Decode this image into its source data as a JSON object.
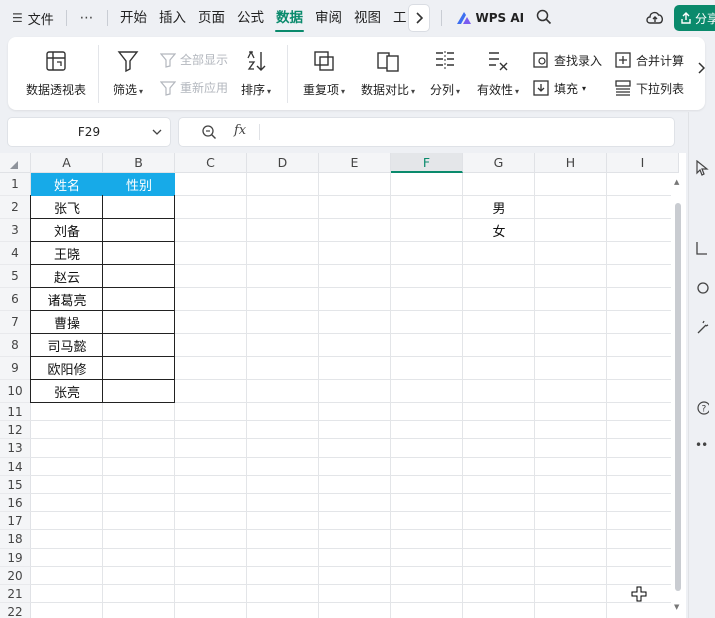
{
  "menubar": {
    "file_label": "文件",
    "more_label": "⋯",
    "tabs": [
      {
        "label": "开始"
      },
      {
        "label": "插入"
      },
      {
        "label": "页面"
      },
      {
        "label": "公式"
      },
      {
        "label": "数据"
      },
      {
        "label": "审阅"
      },
      {
        "label": "视图"
      },
      {
        "label": "工"
      }
    ],
    "active_tab": "数据",
    "wps_ai_label": "WPS AI",
    "share_label": "分享"
  },
  "ribbon": {
    "pivot": "数据透视表",
    "filter": "筛选",
    "show_all": "全部显示",
    "reapply": "重新应用",
    "sort": "排序",
    "duplicates": "重复项",
    "compare": "数据对比",
    "split": "分列",
    "validity": "有效性",
    "lookup_entry": "查找录入",
    "fill": "填充",
    "merge_calc": "合并计算",
    "dropdown_list": "下拉列表"
  },
  "formula_bar": {
    "cell_ref": "F29",
    "fx_label": "fx",
    "value": ""
  },
  "sheet": {
    "columns": [
      "A",
      "B",
      "C",
      "D",
      "E",
      "F",
      "G",
      "H",
      "I"
    ],
    "selected_column": "F",
    "rows": [
      "1",
      "2",
      "3",
      "4",
      "5",
      "6",
      "7",
      "8",
      "9",
      "10",
      "11",
      "12",
      "13",
      "14",
      "15",
      "16",
      "17",
      "18",
      "19",
      "20",
      "21",
      "22"
    ],
    "header": {
      "a1": "姓名",
      "b1": "性别"
    },
    "names": [
      "张飞",
      "刘备",
      "王晓",
      "赵云",
      "诸葛亮",
      "曹操",
      "司马懿",
      "欧阳修",
      "张亮"
    ],
    "gender_options": [
      "男",
      "女"
    ]
  },
  "colors": {
    "accent": "#0a8a6c",
    "header_fill": "#17aae8"
  }
}
